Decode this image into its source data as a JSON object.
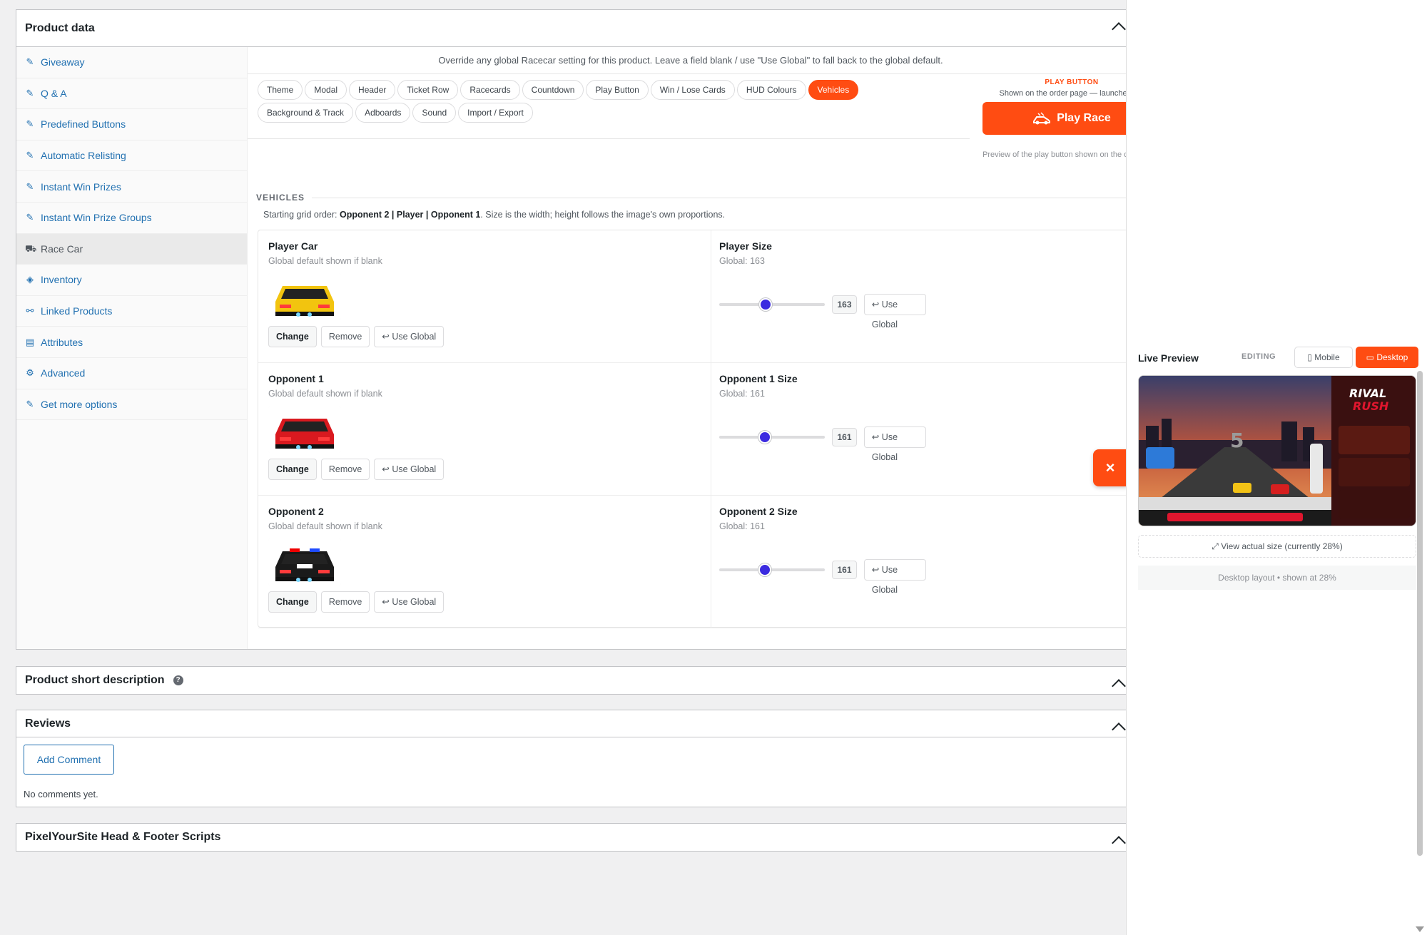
{
  "product_data": {
    "title": "Product data",
    "sidebar": [
      {
        "label": "Giveaway",
        "icon": "giveaway-icon"
      },
      {
        "label": "Q & A",
        "icon": "qa-icon"
      },
      {
        "label": "Predefined Buttons",
        "icon": "buttons-icon"
      },
      {
        "label": "Automatic Relisting",
        "icon": "relist-icon"
      },
      {
        "label": "Instant Win Prizes",
        "icon": "prize-icon"
      },
      {
        "label": "Instant Win Prize Groups",
        "icon": "prize-group-icon"
      },
      {
        "label": "Race Car",
        "icon": "race-car-icon",
        "active": true
      },
      {
        "label": "Inventory",
        "icon": "inventory-icon"
      },
      {
        "label": "Linked Products",
        "icon": "link-icon"
      },
      {
        "label": "Attributes",
        "icon": "attributes-icon"
      },
      {
        "label": "Advanced",
        "icon": "gear-icon"
      },
      {
        "label": "Get more options",
        "icon": "plugin-icon"
      }
    ],
    "notice": "Override any global Racecar setting for this product. Leave a field blank / use \"Use Global\" to fall back to the global default.",
    "tabs": [
      "Theme",
      "Modal",
      "Header",
      "Ticket Row",
      "Racecards",
      "Countdown",
      "Play Button",
      "Win / Lose Cards",
      "HUD Colours",
      "Vehicles",
      "Background & Track",
      "Adboards",
      "Sound",
      "Import / Export"
    ],
    "active_tab": "Vehicles",
    "play_button": {
      "kicker": "PLAY BUTTON",
      "note": "Shown on the order page — launches the",
      "label": "Play Race",
      "preview_note": "Preview of the play button shown on the o"
    },
    "section_title": "VEHICLES",
    "grid_note_prefix": "Starting grid order: ",
    "grid_order": "Opponent 2 | Player | Opponent 1",
    "grid_note_suffix": ". Size is the width; height follows the image's own proportions.",
    "vehicles": [
      {
        "label": "Player Car",
        "sub": "Global default shown if blank",
        "size_label": "Player Size",
        "global": "Global: 163",
        "value": "163",
        "fraction": 0.38
      },
      {
        "label": "Opponent 1",
        "sub": "Global default shown if blank",
        "size_label": "Opponent 1 Size",
        "global": "Global: 161",
        "value": "161",
        "fraction": 0.37
      },
      {
        "label": "Opponent 2",
        "sub": "Global default shown if blank",
        "size_label": "Opponent 2 Size",
        "global": "Global: 161",
        "value": "161",
        "fraction": 0.37
      }
    ],
    "buttons": {
      "change": "Change",
      "remove": "Remove",
      "use_global": "↩ Use Global"
    }
  },
  "short_desc": {
    "title": "Product short description"
  },
  "reviews": {
    "title": "Reviews",
    "add": "Add Comment",
    "empty": "No comments yet."
  },
  "pys": {
    "title": "PixelYourSite Head & Footer Scripts"
  },
  "preview": {
    "title": "Live Preview",
    "editing": "EDITING",
    "mobile": "Mobile",
    "desktop": "Desktop",
    "game_title": "RIVAL",
    "game_title2": "RUSH",
    "countdown": "5",
    "view_actual": "View actual size (currently 28%)",
    "layout_note": "Desktop layout • shown at 28%"
  },
  "colors": {
    "accent": "#ff4c12",
    "slider": "#3b2be0",
    "link": "#2271b1"
  }
}
